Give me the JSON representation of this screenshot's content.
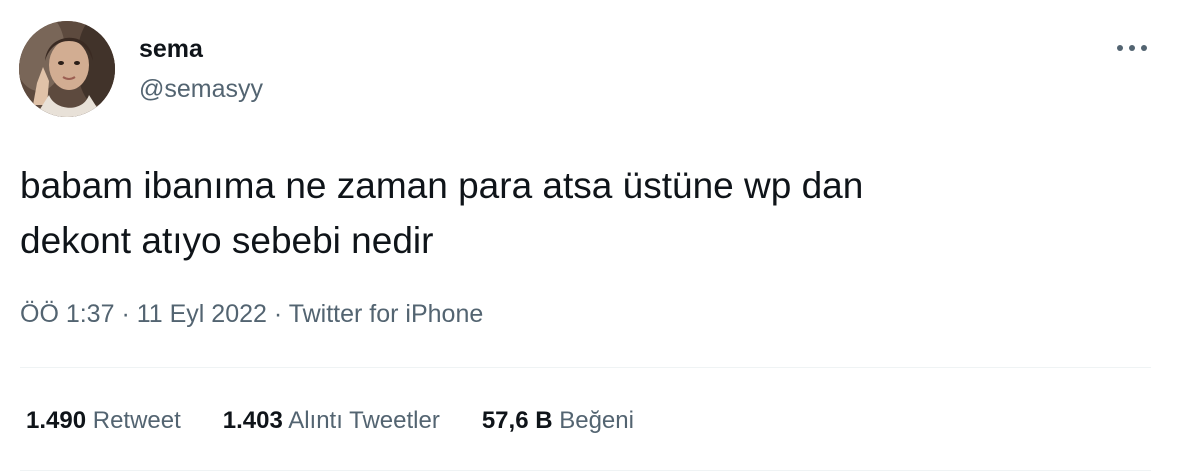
{
  "author": {
    "display_name": "sema",
    "handle": "@semasyy",
    "avatar_icon": "user-avatar-photo"
  },
  "more_icon": "more-options-icon",
  "tweet": {
    "text": "babam ibanıma ne zaman para atsa üstüne wp dan\ndekont atıyo sebebi nedir"
  },
  "meta": {
    "time": "ÖÖ 1:37",
    "date": "11 Eyl 2022",
    "source": "Twitter for iPhone",
    "separator": "·"
  },
  "stats": {
    "retweets": {
      "count": "1.490",
      "label": "Retweet"
    },
    "quotes": {
      "count": "1.403",
      "label": "Alıntı Tweetler"
    },
    "likes": {
      "count": "57,6 B",
      "label": "Beğeni"
    }
  },
  "colors": {
    "text_primary": "#0f1419",
    "text_secondary": "#536471",
    "divider": "#eff3f4"
  }
}
